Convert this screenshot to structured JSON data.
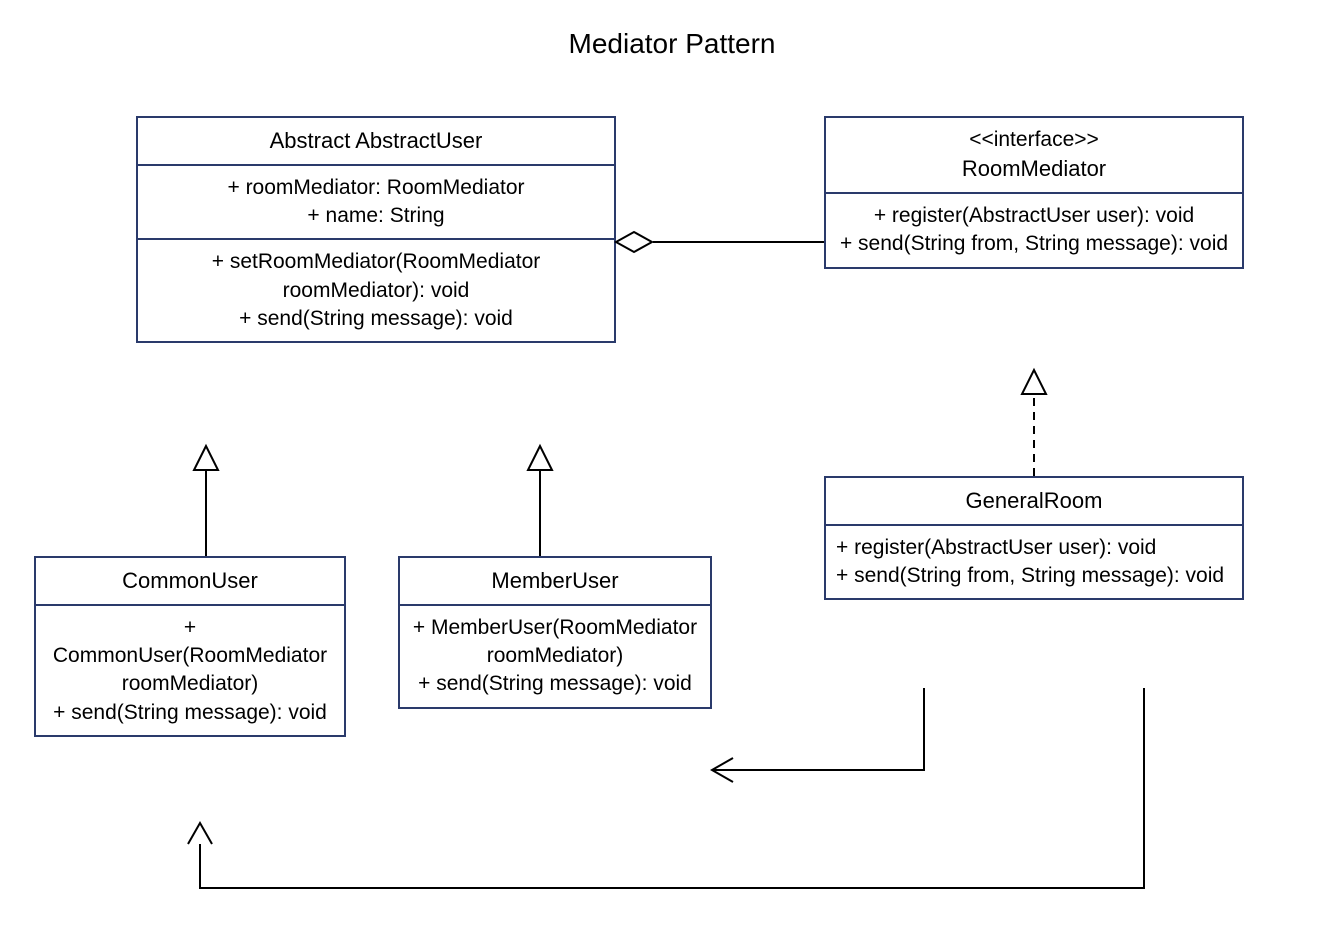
{
  "title": "Mediator Pattern",
  "abstractUser": {
    "name": "Abstract AbstractUser",
    "attrs": "+  roomMediator: RoomMediator\n+  name: String",
    "ops": "+ setRoomMediator(RoomMediator roomMediator): void\n+ send(String message): void"
  },
  "roomMediator": {
    "stereo": "<<interface>>",
    "name": "RoomMediator",
    "ops": "+   register(AbstractUser user): void\n+   send(String from, String message): void"
  },
  "commonUser": {
    "name": "CommonUser",
    "ops": "+ CommonUser(RoomMediator roomMediator)\n+ send(String message): void"
  },
  "memberUser": {
    "name": "MemberUser",
    "ops": "+ MemberUser(RoomMediator roomMediator)\n+ send(String message): void"
  },
  "generalRoom": {
    "name": "GeneralRoom",
    "ops": "+   register(AbstractUser user): void\n+   send(String from, String message): void"
  }
}
